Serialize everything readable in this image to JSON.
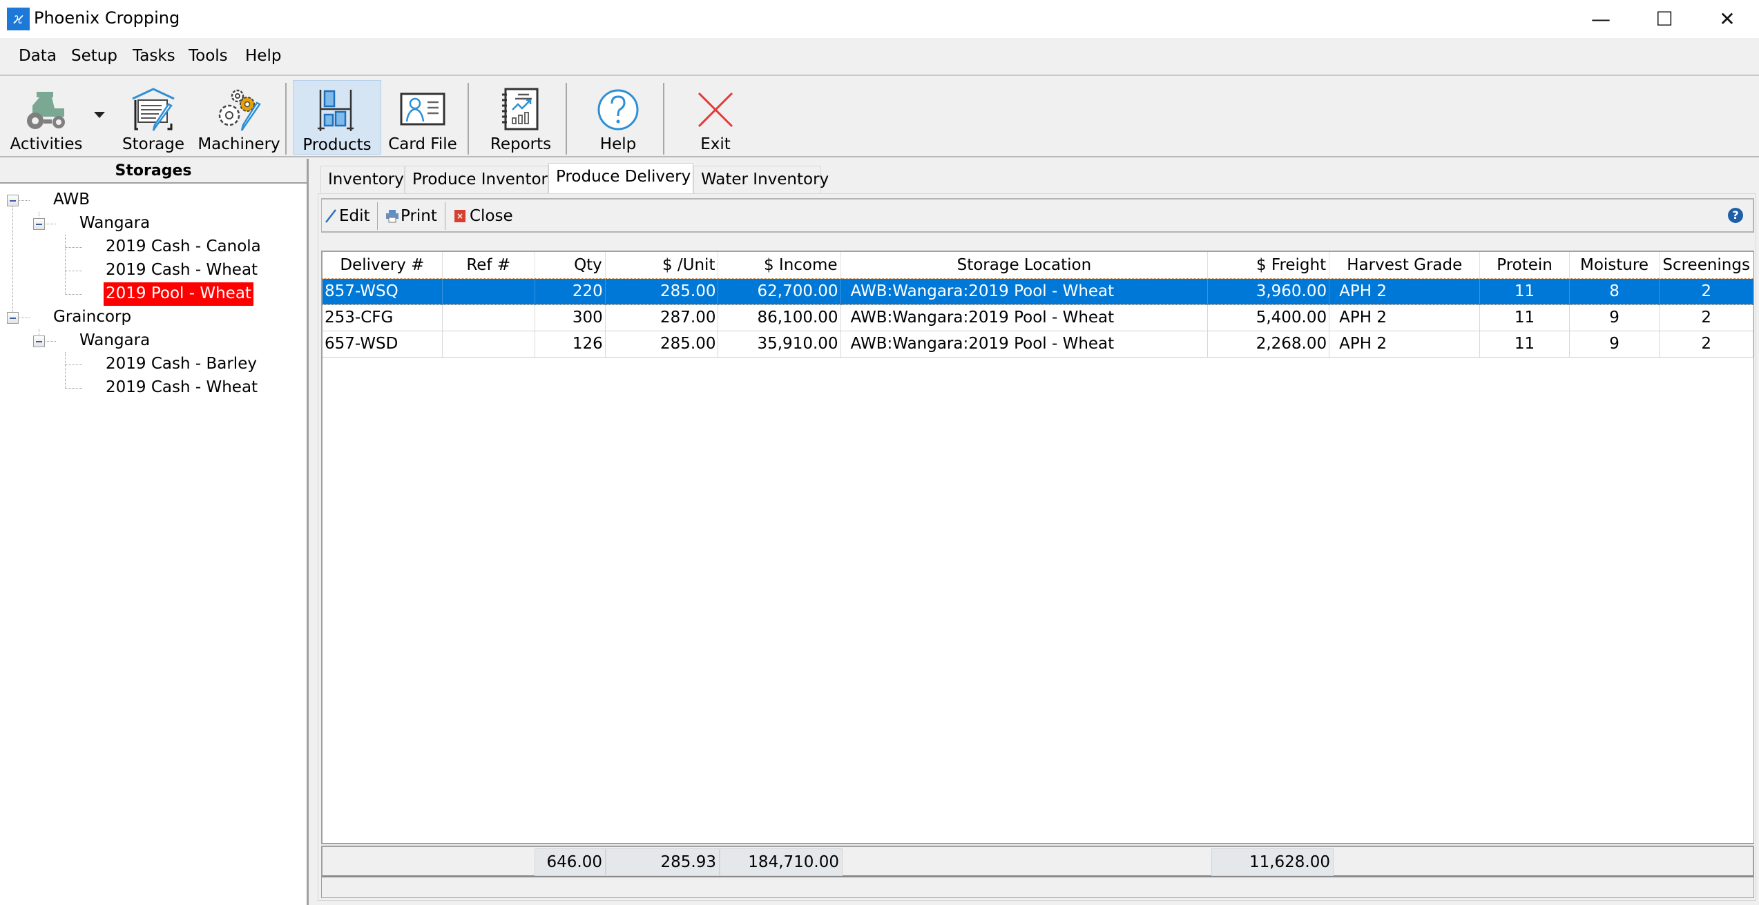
{
  "window": {
    "title": "Phoenix Cropping",
    "app_icon_glyph": "ϰ",
    "controls": {
      "minimize": "—",
      "maximize": "☐",
      "close": "✕"
    }
  },
  "menubar": {
    "items": [
      "Data",
      "Setup",
      "Tasks",
      "Tools",
      "Help"
    ]
  },
  "toolbar": {
    "buttons": [
      {
        "label": "Activities",
        "icon": "tractor-icon",
        "has_dropdown": true
      },
      {
        "label": "Storage",
        "icon": "storage-shed-edit-icon"
      },
      {
        "label": "Machinery",
        "icon": "gears-edit-icon"
      },
      {
        "label": "Products",
        "icon": "shelving-products-icon",
        "active": true
      },
      {
        "label": "Card File",
        "icon": "contact-card-icon"
      },
      {
        "label": "Reports",
        "icon": "report-chart-icon"
      },
      {
        "label": "Help",
        "icon": "help-circle-icon"
      },
      {
        "label": "Exit",
        "icon": "exit-x-icon"
      }
    ]
  },
  "sidebar": {
    "header": "Storages",
    "tree": [
      {
        "label": "AWB",
        "level": 0,
        "expanded": true
      },
      {
        "label": "Wangara",
        "level": 1,
        "expanded": true
      },
      {
        "label": "2019 Cash - Canola",
        "level": 2
      },
      {
        "label": "2019 Cash - Wheat",
        "level": 2
      },
      {
        "label": "2019 Pool - Wheat",
        "level": 2,
        "selected": true
      },
      {
        "label": "Graincorp",
        "level": 0,
        "expanded": true
      },
      {
        "label": "Wangara",
        "level": 1,
        "expanded": true
      },
      {
        "label": "2019 Cash - Barley",
        "level": 2
      },
      {
        "label": "2019 Cash - Wheat",
        "level": 2
      }
    ],
    "selected_color": "#ff0000"
  },
  "tabs": [
    {
      "label": "Inventory"
    },
    {
      "label": "Produce Inventory"
    },
    {
      "label": "Produce Delivery",
      "active": true
    },
    {
      "label": "Water Inventory"
    }
  ],
  "subtoolbar": {
    "edit": "Edit",
    "print": "Print",
    "close": "Close",
    "help_glyph": "?"
  },
  "grid": {
    "columns": [
      "Delivery #",
      "Ref #",
      "Qty",
      "$ /Unit",
      "$ Income",
      "Storage Location",
      "$ Freight",
      "Harvest Grade",
      "Protein",
      "Moisture",
      "Screenings"
    ],
    "rows": [
      [
        "857-WSQ",
        "",
        "220",
        "285.00",
        "62,700.00",
        "AWB:Wangara:2019 Pool - Wheat",
        "3,960.00",
        "APH 2",
        "11",
        "8",
        "2"
      ],
      [
        "253-CFG",
        "",
        "300",
        "287.00",
        "86,100.00",
        "AWB:Wangara:2019 Pool - Wheat",
        "5,400.00",
        "APH 2",
        "11",
        "9",
        "2"
      ],
      [
        "657-WSD",
        "",
        "126",
        "285.00",
        "35,910.00",
        "AWB:Wangara:2019 Pool - Wheat",
        "2,268.00",
        "APH 2",
        "11",
        "9",
        "2"
      ]
    ],
    "selected_row": 0,
    "selection_color": "#0078d7",
    "totals": {
      "qty": "646.00",
      "unit": "285.93",
      "income": "184,710.00",
      "freight": "11,628.00"
    }
  }
}
